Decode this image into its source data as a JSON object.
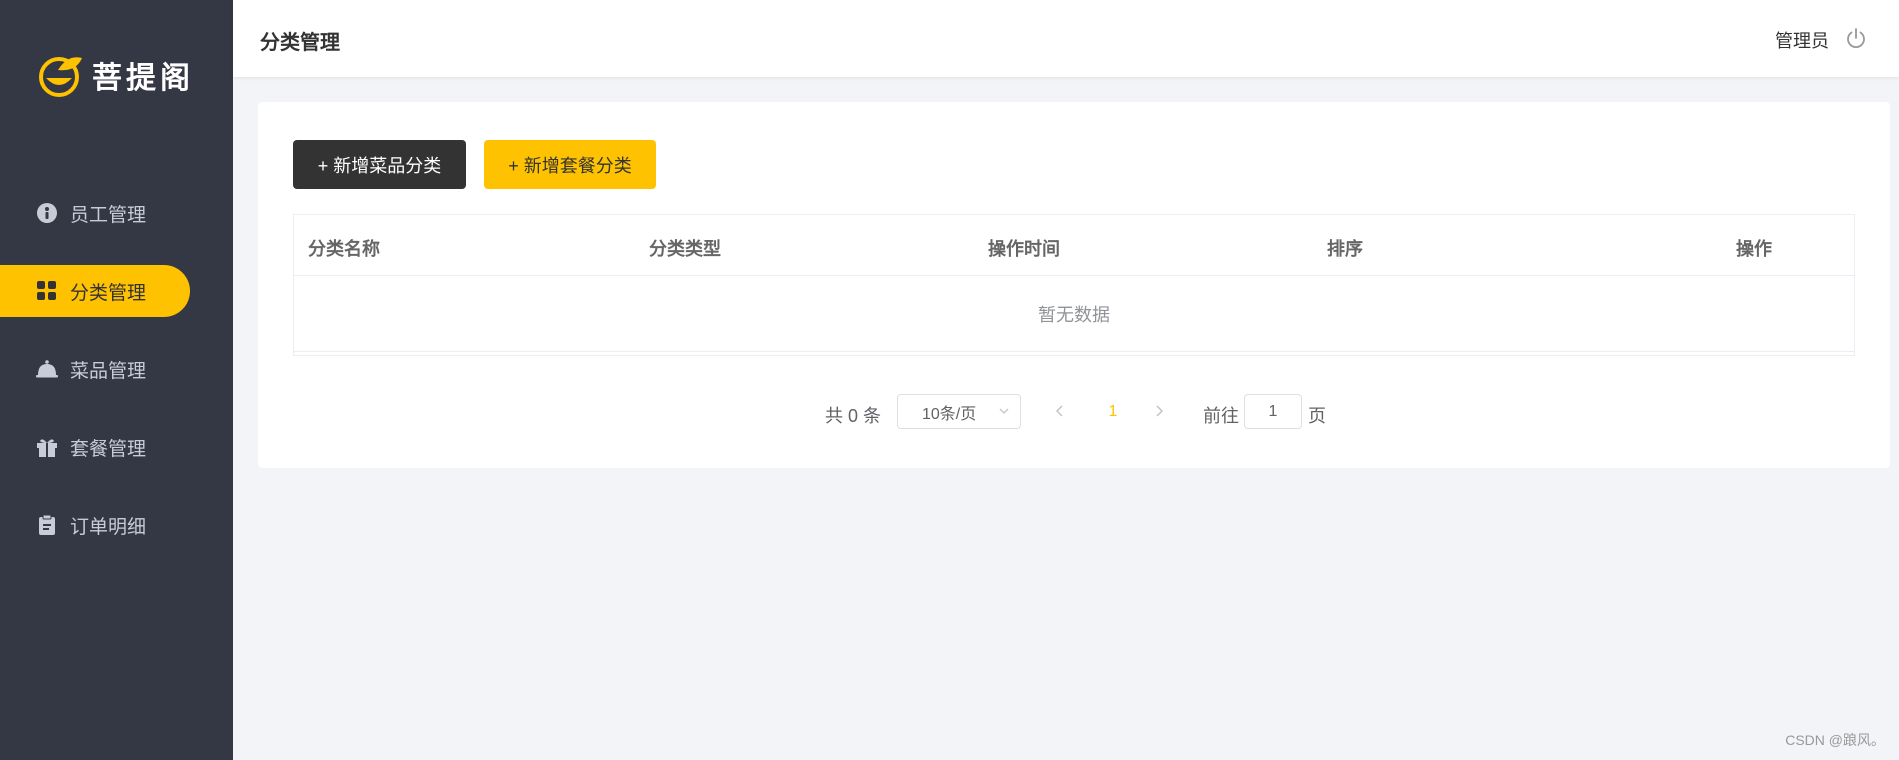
{
  "brand": {
    "name": "菩提阁"
  },
  "sidebar": {
    "items": [
      {
        "label": "员工管理",
        "icon": "employee-icon",
        "active": false
      },
      {
        "label": "分类管理",
        "icon": "category-grid-icon",
        "active": true
      },
      {
        "label": "菜品管理",
        "icon": "dish-cloche-icon",
        "active": false
      },
      {
        "label": "套餐管理",
        "icon": "gift-icon",
        "active": false
      },
      {
        "label": "订单明细",
        "icon": "clipboard-icon",
        "active": false
      }
    ]
  },
  "header": {
    "title": "分类管理",
    "user": "管理员",
    "logout_icon": "power-icon"
  },
  "toolbar": {
    "add_dish_category": "+ 新增菜品分类",
    "add_setmeal_category": "+ 新增套餐分类"
  },
  "table": {
    "columns": [
      "分类名称",
      "分类类型",
      "操作时间",
      "排序",
      "操作"
    ],
    "empty_text": "暂无数据"
  },
  "pagination": {
    "total_text": "共 0 条",
    "page_size": "10条/页",
    "current_page": "1",
    "goto_label": "前往",
    "goto_value": "1",
    "goto_suffix": "页"
  },
  "watermark": "CSDN @踉风。",
  "colors": {
    "sidebar_bg": "#343744",
    "accent": "#ffc200",
    "dark_button": "#333333"
  }
}
